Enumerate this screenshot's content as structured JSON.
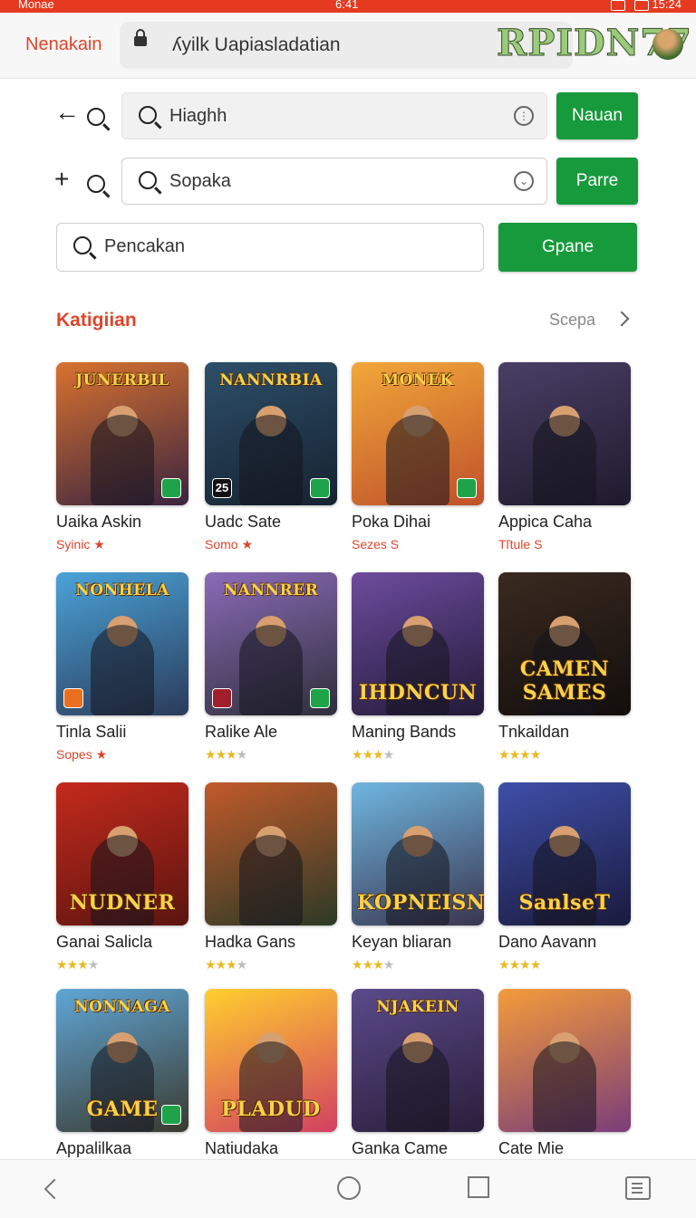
{
  "status_bar": {
    "left_text": "Monae",
    "center_text": "6:41",
    "right_text": "15:24"
  },
  "browser": {
    "tab_label": "Nenakain",
    "url": "ʎyilk Uapiasladatian",
    "brand_text": "RPIDN77"
  },
  "search_rows": [
    {
      "placeholder": "Hiaghh",
      "button": "Nauan"
    },
    {
      "placeholder": "Sopaka",
      "button": "Parre"
    },
    {
      "placeholder": "Pencakan",
      "button": "Gpane"
    }
  ],
  "section": {
    "title": "Katigiian",
    "more": "Scepa"
  },
  "games": [
    {
      "name": "Uaika Askin",
      "sub": "Syinic ★",
      "banner": "JUNERBIL",
      "bg": [
        "#d9722f",
        "#3a2440"
      ],
      "badge": "green"
    },
    {
      "name": "Uadc Sate",
      "sub": "Somo ★",
      "banner": "NANNRBIA",
      "bg": [
        "#2d4f6a",
        "#162230"
      ],
      "badge": "green",
      "badge_num": "25"
    },
    {
      "name": "Poka Dihai",
      "sub": "Sezes S",
      "banner": "MONEK",
      "bg": [
        "#f1a73a",
        "#c0512a"
      ],
      "badge": "green"
    },
    {
      "name": "Appica Caha",
      "sub": "Tľtule S",
      "banner": "",
      "bg": [
        "#4a3f66",
        "#1e1a2c"
      ],
      "badge": "none"
    },
    {
      "name": "Tinla Salii",
      "sub": "Sopes ★",
      "banner": "NONHELA",
      "bg": [
        "#4aa3d8",
        "#2b3b5a"
      ],
      "badge": "orange"
    },
    {
      "name": "Ralike Ale",
      "sub": "",
      "stars": 3,
      "banner": "NANNRER",
      "bg": [
        "#8b6bb8",
        "#2e2f3a"
      ],
      "badge": "green",
      "badge2": "red"
    },
    {
      "name": "Maning Bands",
      "sub": "",
      "stars": 3,
      "banner": "IHDNCUN",
      "bg": [
        "#6d4c9e",
        "#221a38"
      ],
      "badge": "none"
    },
    {
      "name": "Tnkaildan",
      "sub": "",
      "stars": 4,
      "banner": "CAMEN SAMES",
      "bg": [
        "#3a2a20",
        "#120e0c"
      ],
      "badge": "none"
    },
    {
      "name": "Ganai Salicla",
      "sub": "",
      "stars": 3,
      "banner": "NUDNER",
      "bg": [
        "#c42a1c",
        "#5b1410"
      ],
      "badge": "none"
    },
    {
      "name": "Hadka Gans",
      "sub": "",
      "stars": 3,
      "banner": "",
      "bg": [
        "#c25a2a",
        "#2c3a26"
      ],
      "badge": "none"
    },
    {
      "name": "Keyan bliaran",
      "sub": "",
      "stars": 3,
      "banner": "KOPNEISN",
      "bg": [
        "#6fb7e0",
        "#3a3550"
      ],
      "badge": "none"
    },
    {
      "name": "Dano Aavann",
      "sub": "",
      "stars": 4,
      "banner": "SanlseT",
      "bg": [
        "#3e4fa8",
        "#1a1a3e"
      ],
      "badge": "none"
    },
    {
      "name": "Appalilkaa",
      "sub": "",
      "banner": "NONNAGA",
      "banner2": "GAME",
      "bg": [
        "#5fa6d6",
        "#3b3a2e"
      ],
      "badge": "green"
    },
    {
      "name": "Natiudaka",
      "sub": "",
      "banner": "PLADUD",
      "bg": [
        "#ffcf2e",
        "#d33f62"
      ],
      "badge": "none"
    },
    {
      "name": "Ganka Came",
      "sub": "",
      "banner": "NJAKEIN",
      "bg": [
        "#5a4a8a",
        "#2a1e3a"
      ],
      "badge": "none"
    },
    {
      "name": "Cate Mie",
      "sub": "",
      "banner": "",
      "bg": [
        "#f49b3a",
        "#7a3d7a"
      ],
      "badge": "none"
    }
  ]
}
